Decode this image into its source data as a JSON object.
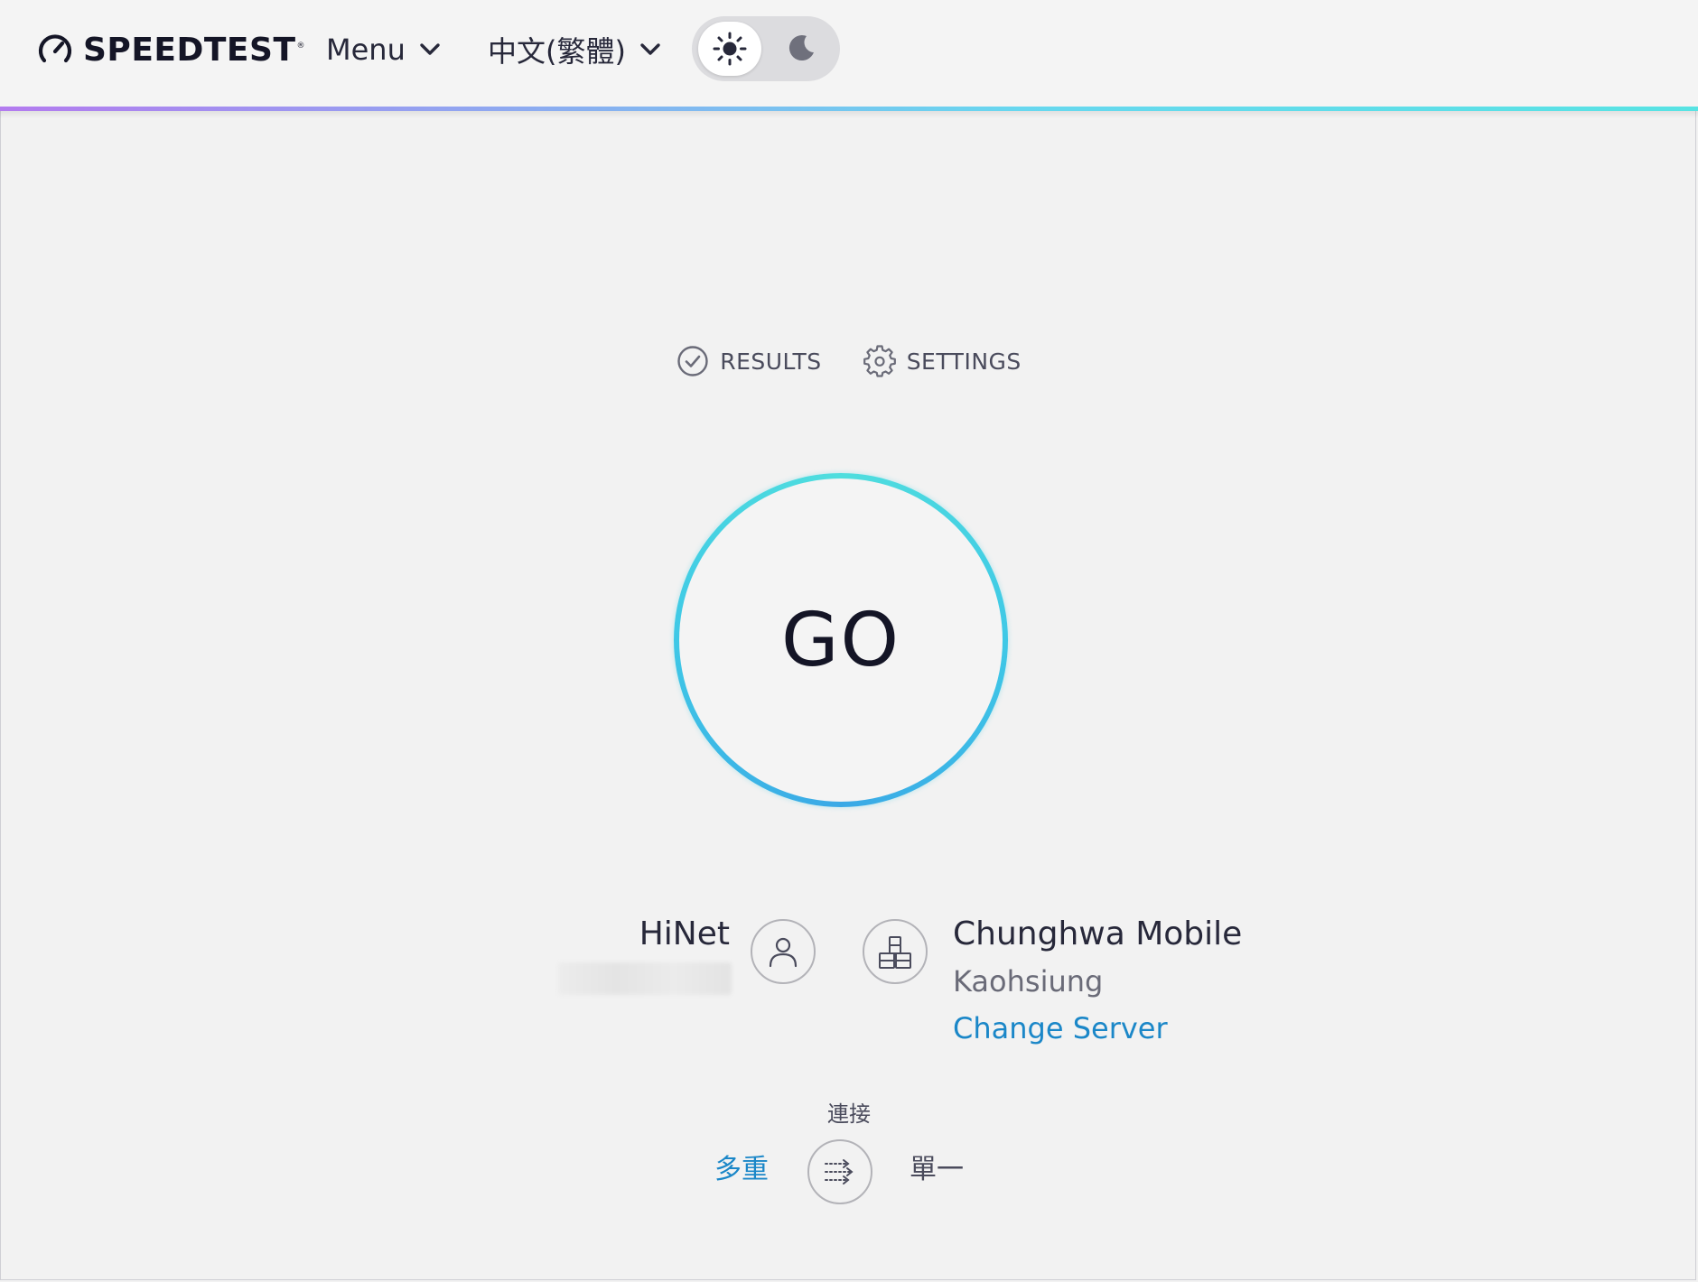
{
  "header": {
    "logo_text": "SPEEDTEST",
    "logo_tm": "®",
    "menu_label": "Menu",
    "language_label": "中文(繁體)",
    "theme": {
      "light_icon": "sun-icon",
      "dark_icon": "moon-icon",
      "active": "light"
    }
  },
  "tabs": {
    "results_label": "RESULTS",
    "settings_label": "SETTINGS"
  },
  "go_button": {
    "label": "GO"
  },
  "provider": {
    "isp_name": "HiNet"
  },
  "server": {
    "name": "Chunghwa Mobile",
    "location": "Kaohsiung",
    "change_label": "Change Server"
  },
  "connections": {
    "label": "連接",
    "multi_label": "多重",
    "single_label": "單一",
    "selected": "multi"
  },
  "colors": {
    "accent_blue": "#1b87c8",
    "ring_cyan": "#4fdede",
    "text_dark": "#141526",
    "background": "#f2f2f2"
  }
}
